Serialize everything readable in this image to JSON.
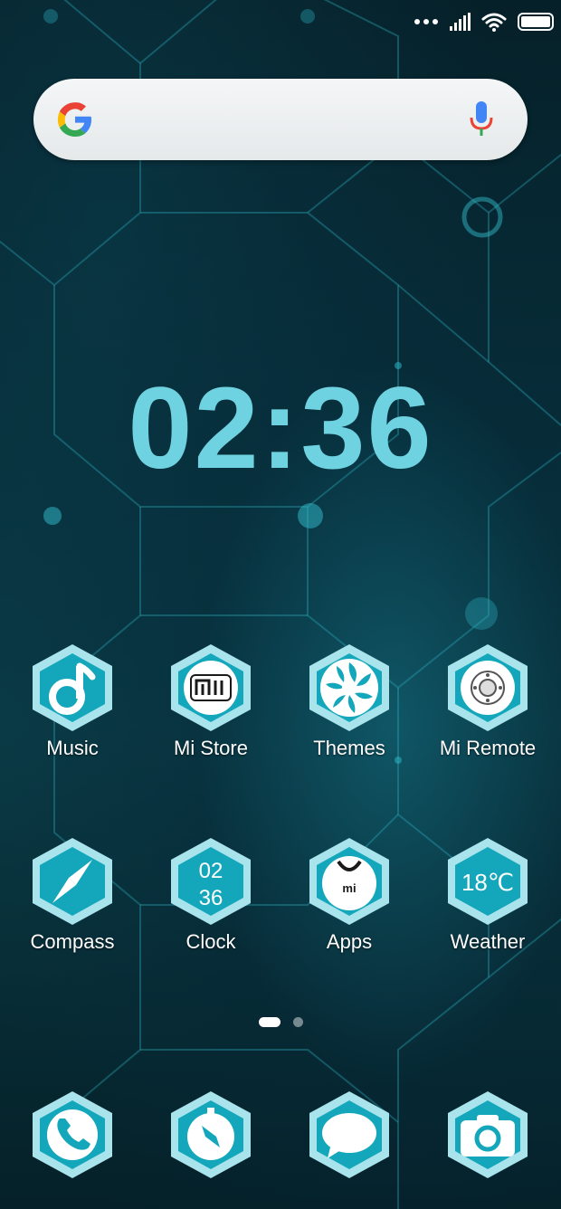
{
  "status_bar": {
    "icons": [
      "more-dots-icon",
      "signal-icon",
      "wifi-icon",
      "battery-icon"
    ]
  },
  "search": {
    "logo": "google-logo-icon",
    "mic": "mic-icon"
  },
  "clock_widget": {
    "time": "02:36"
  },
  "apps": [
    {
      "label": "Music",
      "icon": "music-note-icon"
    },
    {
      "label": "Mi Store",
      "icon": "mi-logo-icon"
    },
    {
      "label": "Themes",
      "icon": "aperture-icon"
    },
    {
      "label": "Mi Remote",
      "icon": "remote-icon"
    },
    {
      "label": "Compass",
      "icon": "compass-icon"
    },
    {
      "label": "Clock",
      "icon": "digital-clock-icon",
      "icon_text_top": "02",
      "icon_text_bottom": "36"
    },
    {
      "label": "Apps",
      "icon": "mi-shirt-icon",
      "icon_text": "mi"
    },
    {
      "label": "Weather",
      "icon": "weather-icon",
      "icon_text": "18℃"
    }
  ],
  "pager": {
    "current": 1,
    "total": 2
  },
  "dock": [
    {
      "icon": "phone-icon"
    },
    {
      "icon": "browser-compass-icon"
    },
    {
      "icon": "message-icon"
    },
    {
      "icon": "camera-icon"
    }
  ],
  "colors": {
    "accent": "#6fd2e0",
    "hex_outer": "#a9e4ec",
    "hex_inner": "#14a7bb"
  }
}
